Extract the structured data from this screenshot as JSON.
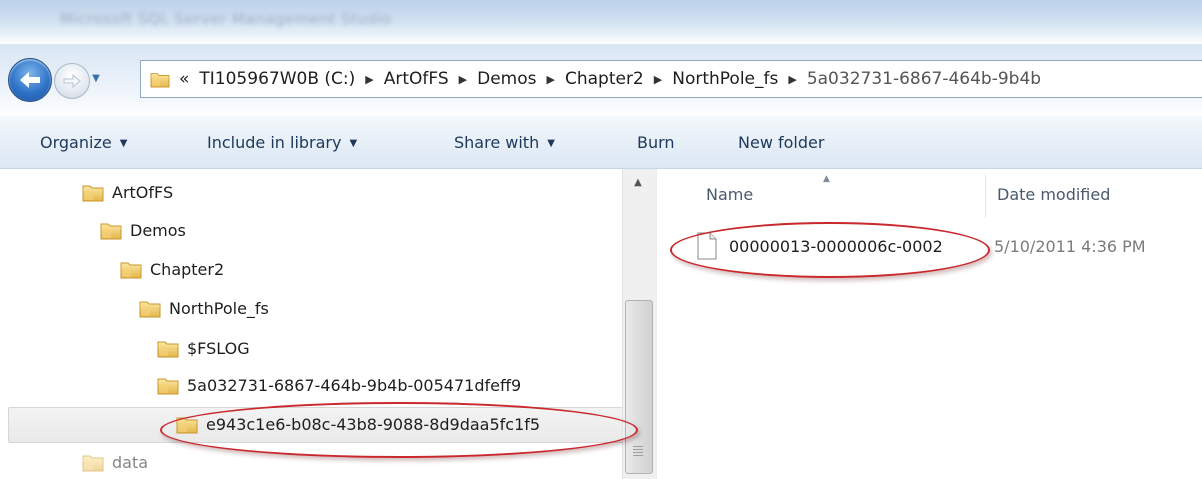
{
  "window": {
    "title": "Microsoft SQL Server Management Studio"
  },
  "address": {
    "overflow_label": "«",
    "crumbs": [
      "TI105967W0B (C:)",
      "ArtOfFS",
      "Demos",
      "Chapter2",
      "NorthPole_fs",
      "5a032731-6867-464b-9b4b"
    ]
  },
  "commands": {
    "organize": "Organize",
    "include_in_library": "Include in library",
    "share_with": "Share with",
    "burn": "Burn",
    "new_folder": "New folder"
  },
  "nav_tree": [
    {
      "label": "ArtOfFS"
    },
    {
      "label": "Demos"
    },
    {
      "label": "Chapter2"
    },
    {
      "label": "NorthPole_fs"
    },
    {
      "label": "$FSLOG"
    },
    {
      "label": "5a032731-6867-464b-9b4b-005471dfeff9"
    },
    {
      "label": "e943c1e6-b08c-43b8-9088-8d9daa5fc1f5",
      "selected": true
    },
    {
      "label": "data"
    }
  ],
  "file_list": {
    "columns": [
      "Name",
      "Date modified"
    ],
    "rows": [
      {
        "name": "00000013-0000006c-0002",
        "date_modified": "5/10/2011 4:36 PM"
      }
    ]
  },
  "colors": {
    "callout": "#c9282d",
    "accent": "#1e395b",
    "folder": "#e8c15a"
  }
}
